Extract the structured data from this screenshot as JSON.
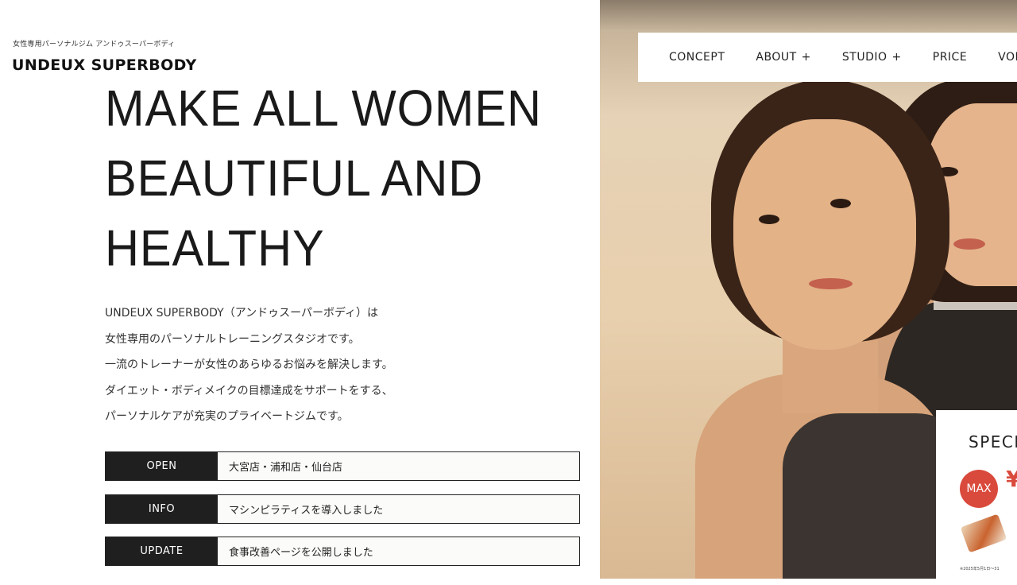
{
  "brand": {
    "subtitle": "女性専用パーソナルジム アンドゥスーパーボディ",
    "name": "UNDEUX SUPERBODY"
  },
  "headline": [
    "MAKE ALL WOMEN",
    "BEAUTIFUL AND",
    "HEALTHY"
  ],
  "intro": [
    "UNDEUX SUPERBODY（アンドゥスーパーボディ）は",
    "女性専用のパーソナルトレーニングスタジオです。",
    "一流のトレーナーが女性のあらゆるお悩みを解決します。",
    "ダイエット・ボディメイクの目標達成をサポートをする、",
    "パーソナルケアが充実のプライベートジムです。"
  ],
  "news": [
    {
      "tag": "OPEN",
      "text": "大宮店・浦和店・仙台店"
    },
    {
      "tag": "INFO",
      "text": "マシンピラティスを導入しました"
    },
    {
      "tag": "UPDATE",
      "text": "食事改善ページを公開しました"
    }
  ],
  "nav": {
    "items": [
      {
        "label": "CONCEPT",
        "plus": ""
      },
      {
        "label": "ABOUT",
        "plus": "+"
      },
      {
        "label": "STUDIO",
        "plus": "+"
      },
      {
        "label": "PRICE",
        "plus": ""
      },
      {
        "label": "VOICE",
        "plus": ""
      }
    ]
  },
  "special": {
    "title": "SPECI",
    "badge": "MAX",
    "red_text": "¥",
    "fine_print": "※2025年5月1日〜31"
  },
  "colors": {
    "accent_red": "#d94a3c",
    "tag_bg": "#1f1f1f"
  }
}
